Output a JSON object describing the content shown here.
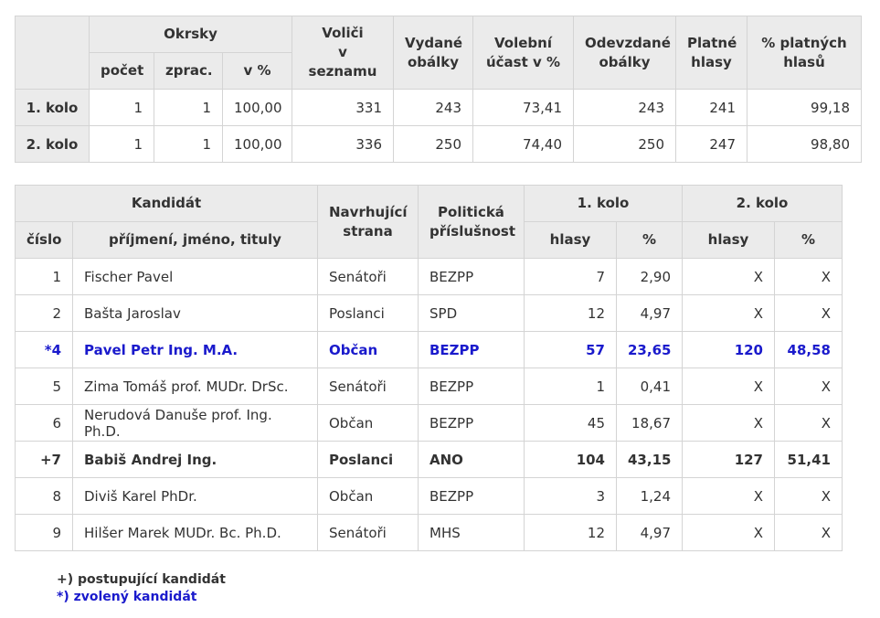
{
  "summary": {
    "headers": {
      "okrsky": "Okrsky",
      "pocet": "počet",
      "zprac": "zprac.",
      "vpct": "v %",
      "volici_a": "Voliči",
      "volici_b": "v seznamu",
      "vydane_a": "Vydané",
      "vydane_b": "obálky",
      "ucast_a": "Volební",
      "ucast_b": "účast v %",
      "odevzdane_a": "Odevzdané",
      "odevzdane_b": "obálky",
      "platne_a": "Platné",
      "platne_b": "hlasy",
      "pct_platnych_a": "% platných",
      "pct_platnych_b": "hlasů"
    },
    "rows": [
      {
        "label": "1. kolo",
        "pocet": "1",
        "zprac": "1",
        "vpct": "100,00",
        "volici": "331",
        "vydane": "243",
        "ucast": "73,41",
        "odevzdane": "243",
        "platne": "241",
        "pct_platnych": "99,18"
      },
      {
        "label": "2. kolo",
        "pocet": "1",
        "zprac": "1",
        "vpct": "100,00",
        "volici": "336",
        "vydane": "250",
        "ucast": "74,40",
        "odevzdane": "250",
        "platne": "247",
        "pct_platnych": "98,80"
      }
    ]
  },
  "candidates": {
    "headers": {
      "kandidat": "Kandidát",
      "cislo": "číslo",
      "jmeno": "příjmení, jméno, tituly",
      "strana_a": "Navrhující",
      "strana_b": "strana",
      "prislusnost_a": "Politická",
      "prislusnost_b": "příslušnost",
      "kolo1": "1. kolo",
      "kolo2": "2. kolo",
      "hlasy1": "hlasy",
      "pct1": "%",
      "hlasy2": "hlasy",
      "pct2": "%"
    },
    "rows": [
      {
        "cislo": "1",
        "jmeno": "Fischer Pavel",
        "strana": "Senátoři",
        "prislusnost": "BEZPP",
        "hlasy1": "7",
        "pct1": "2,90",
        "hlasy2": "X",
        "pct2": "X",
        "status": "none"
      },
      {
        "cislo": "2",
        "jmeno": "Bašta Jaroslav",
        "strana": "Poslanci",
        "prislusnost": "SPD",
        "hlasy1": "12",
        "pct1": "4,97",
        "hlasy2": "X",
        "pct2": "X",
        "status": "none"
      },
      {
        "cislo": "*4",
        "jmeno": "Pavel Petr Ing. M.A.",
        "strana": "Občan",
        "prislusnost": "BEZPP",
        "hlasy1": "57",
        "pct1": "23,65",
        "hlasy2": "120",
        "pct2": "48,58",
        "status": "elected"
      },
      {
        "cislo": "5",
        "jmeno": "Zima Tomáš prof. MUDr. DrSc.",
        "strana": "Senátoři",
        "prislusnost": "BEZPP",
        "hlasy1": "1",
        "pct1": "0,41",
        "hlasy2": "X",
        "pct2": "X",
        "status": "none"
      },
      {
        "cislo": "6",
        "jmeno": "Nerudová Danuše prof. Ing. Ph.D.",
        "strana": "Občan",
        "prislusnost": "BEZPP",
        "hlasy1": "45",
        "pct1": "18,67",
        "hlasy2": "X",
        "pct2": "X",
        "status": "none"
      },
      {
        "cislo": "+7",
        "jmeno": "Babiš Andrej Ing.",
        "strana": "Poslanci",
        "prislusnost": "ANO",
        "hlasy1": "104",
        "pct1": "43,15",
        "hlasy2": "127",
        "pct2": "51,41",
        "status": "advancing"
      },
      {
        "cislo": "8",
        "jmeno": "Diviš Karel PhDr.",
        "strana": "Občan",
        "prislusnost": "BEZPP",
        "hlasy1": "3",
        "pct1": "1,24",
        "hlasy2": "X",
        "pct2": "X",
        "status": "none"
      },
      {
        "cislo": "9",
        "jmeno": "Hilšer Marek MUDr. Bc. Ph.D.",
        "strana": "Senátoři",
        "prislusnost": "MHS",
        "hlasy1": "12",
        "pct1": "4,97",
        "hlasy2": "X",
        "pct2": "X",
        "status": "none"
      }
    ]
  },
  "legend": {
    "advancing": "+) postupující kandidát",
    "elected": "*) zvolený kandidát"
  },
  "colors": {
    "header_bg": "#ebebeb",
    "border": "#d4d4d4",
    "text": "#333333",
    "elected": "#1a1acc"
  }
}
